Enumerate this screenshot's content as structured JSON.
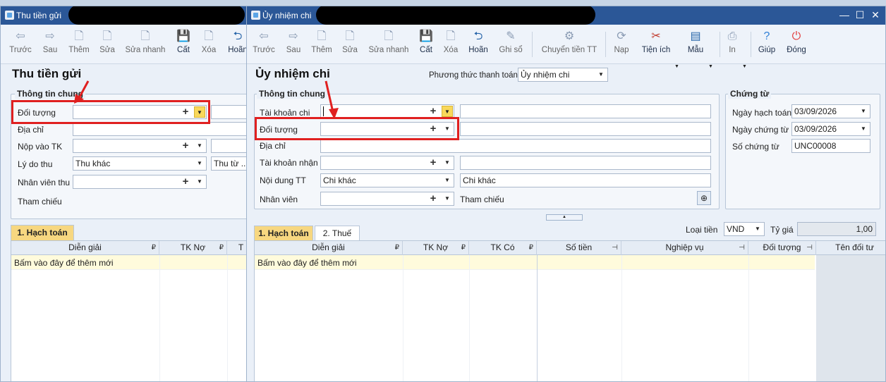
{
  "back_window": {
    "title": "Thu tiền gửi",
    "toolbar": [
      {
        "label": "Trước",
        "icon": "arrow-left-icon"
      },
      {
        "label": "Sau",
        "icon": "arrow-right-icon"
      },
      {
        "label": "Thêm",
        "icon": "new-document-icon"
      },
      {
        "label": "Sửa",
        "icon": "edit-document-icon"
      },
      {
        "label": "Sửa nhanh",
        "icon": "quick-edit-icon"
      },
      {
        "label": "Cất",
        "icon": "save-icon"
      },
      {
        "label": "Xóa",
        "icon": "delete-icon"
      },
      {
        "label": "Hoãn",
        "icon": "undo-icon"
      }
    ],
    "page_title": "Thu tiền gửi",
    "group_title": "Thông tin chung",
    "fields": {
      "doi_tuong": "Đối tượng",
      "dia_chi": "Địa chỉ",
      "nop_vao_tk": "Nộp vào TK",
      "ly_do_thu": "Lý do thu",
      "ly_do_thu_value": "Thu khác",
      "ly_do_thu_desc": "Thu từ ...",
      "nhan_vien_thu": "Nhân viên thu",
      "tham_chieu": "Tham chiếu"
    },
    "tab_hach_toan": "1. Hạch toán",
    "grid_headers": [
      "Diễn giải",
      "TK Nợ",
      "T"
    ],
    "grid_add_row": "Bấm vào đây để thêm mới"
  },
  "front_window": {
    "title": "Ủy nhiệm chi",
    "window_controls": {
      "minimize": "—",
      "maximize": "☐",
      "close": "✕"
    },
    "toolbar": [
      {
        "label": "Trước",
        "icon": "arrow-left-icon",
        "active": false
      },
      {
        "label": "Sau",
        "icon": "arrow-right-icon",
        "active": false
      },
      {
        "label": "Thêm",
        "icon": "new-document-icon",
        "active": false
      },
      {
        "label": "Sửa",
        "icon": "edit-document-icon",
        "active": false
      },
      {
        "label": "Sửa nhanh",
        "icon": "quick-edit-icon",
        "active": false
      },
      {
        "label": "Cất",
        "icon": "save-icon",
        "active": true
      },
      {
        "label": "Xóa",
        "icon": "delete-icon",
        "active": false
      },
      {
        "label": "Hoãn",
        "icon": "undo-icon",
        "active": true
      },
      {
        "label": "Ghi sổ",
        "icon": "pen-icon",
        "active": false
      },
      {
        "label": "Chuyển tiền TT",
        "icon": "transfer-icon",
        "active": false
      },
      {
        "label": "Nạp",
        "icon": "refresh-icon",
        "active": false
      },
      {
        "label": "Tiện ích",
        "icon": "tools-icon",
        "active": true
      },
      {
        "label": "Mẫu",
        "icon": "template-icon",
        "active": true
      },
      {
        "label": "In",
        "icon": "print-icon",
        "active": false
      },
      {
        "label": "Giúp",
        "icon": "help-icon",
        "active": true
      },
      {
        "label": "Đóng",
        "icon": "power-icon",
        "active": true
      }
    ],
    "page_title": "Ủy nhiệm chi",
    "payment_method_label": "Phương thức thanh toán",
    "payment_method_value": "Ủy nhiệm chi",
    "group_general": "Thông tin chung",
    "fields": {
      "tai_khoan_chi": "Tài khoản chi",
      "doi_tuong": "Đối tượng",
      "dia_chi": "Địa chỉ",
      "tai_khoan_nhan": "Tài khoản nhận",
      "noi_dung_tt": "Nội dung TT",
      "noi_dung_tt_value": "Chi khác",
      "noi_dung_tt_desc": "Chi khác",
      "nhan_vien": "Nhân viên",
      "tham_chieu": "Tham chiếu"
    },
    "group_voucher": "Chứng từ",
    "voucher": {
      "ngay_hach_toan_label": "Ngày hạch toán",
      "ngay_hach_toan": "03/09/2026",
      "ngay_chung_tu_label": "Ngày chứng từ",
      "ngay_chung_tu": "03/09/2026",
      "so_chung_tu_label": "Số chứng từ",
      "so_chung_tu": "UNC00008"
    },
    "currency_label": "Loại tiền",
    "currency_value": "VND",
    "rate_label": "Tỷ giá",
    "rate_value": "1,00",
    "tabs": [
      "1. Hạch toán",
      "2. Thuế"
    ],
    "grid_headers": [
      "Diễn giải",
      "TK Nợ",
      "TK Có",
      "Số tiền",
      "Nghiệp vụ",
      "Đối tượng",
      "Tên đối tư"
    ],
    "grid_add_row": "Bấm vào đây để thêm mới"
  },
  "colors": {
    "titlebar": "#2b5797",
    "highlight_box": "#e02020",
    "active_tab": "#f7d780",
    "add_row": "#fffbdc"
  }
}
